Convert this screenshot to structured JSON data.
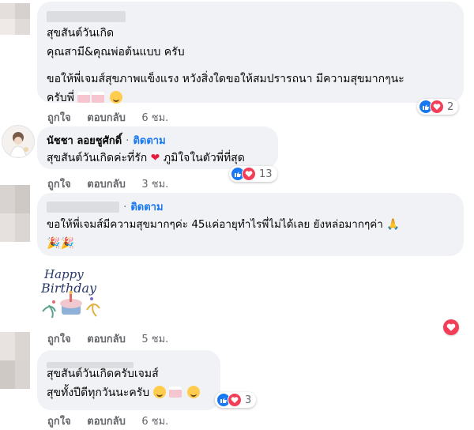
{
  "comments": [
    {
      "author": "",
      "lines": [
        "สุขสันต์วันเกิด",
        "คุณสามี&คุณพ่อต้นแบบ ครับ",
        "",
        "ขอให้พี่เจมส์สุขภาพแข็งแรง หวังสิ่งใดขอให้สมปรารถนา มีความสุขมากๆนะ",
        "ครับพี่"
      ],
      "actions": {
        "like": "ถูกใจ",
        "reply": "ตอบกลับ",
        "time": "6 ชม."
      },
      "reaction_count": "2"
    },
    {
      "author": "นัชชา ลอยชูศักดิ์",
      "follow": "ติดตาม",
      "separator": "·",
      "lines": [
        "สุขสันต์วันเกิดค่ะที่รัก",
        "ภูมิใจในตัวพี่ที่สุด"
      ],
      "actions": {
        "like": "ถูกใจ",
        "reply": "ตอบกลับ",
        "time": "3 ชม."
      },
      "reaction_count": "13"
    },
    {
      "author": "",
      "follow": "ติดตาม",
      "separator": "·",
      "lines": [
        "ขอให้พี่เจมส์มีความสุขมากๆค่ะ 45แค่อายุทำไรพี่ไม่ได้เลย ยังหล่อมากๆค่า"
      ],
      "sticker": {
        "line1": "Happy",
        "line2": "Birthday"
      },
      "actions": {
        "like": "ถูกใจ",
        "reply": "ตอบกลับ",
        "time": "5 ชม."
      }
    },
    {
      "author": "",
      "lines": [
        "สุขสันต์วันเกิดครับเจมส์",
        "สุขทั้งปีดีทุกวันนะครับ"
      ],
      "actions": {
        "like": "ถูกใจ",
        "reply": "ตอบกลับ",
        "time": "6 ชม."
      },
      "reaction_count": "3"
    }
  ],
  "icons": {
    "like": "like-icon",
    "love": "love-icon",
    "heart": "red-heart-emoji",
    "cake": "birthday-cake-emoji",
    "smile": "smiling-face-emoji",
    "pray": "folded-hands-emoji",
    "party": "party-popper-emoji"
  },
  "colors": {
    "bubble": "#f0f2f5",
    "link": "#1877f2",
    "meta": "#65676b",
    "like": "#1877f2",
    "love": "#f33e58"
  }
}
